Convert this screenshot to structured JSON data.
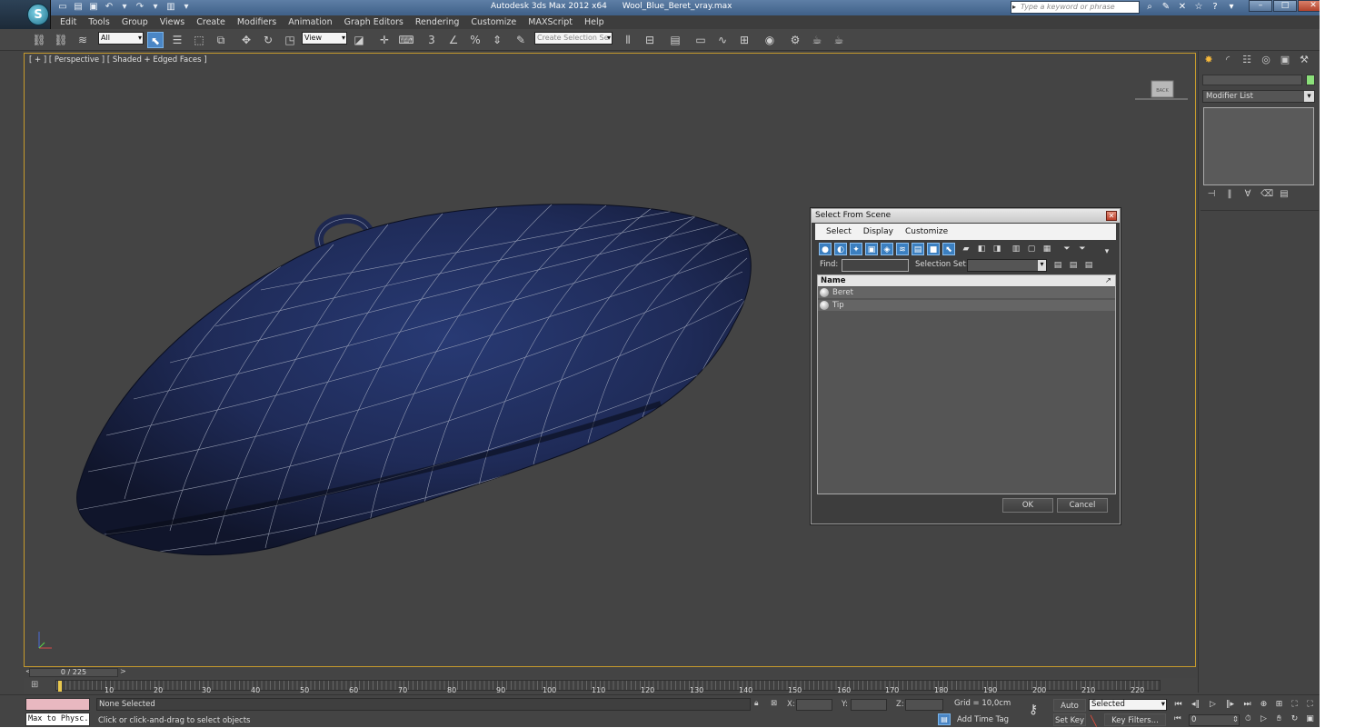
{
  "app": {
    "title": "Autodesk 3ds Max  2012 x64",
    "file": "Wool_Blue_Beret_vray.max",
    "search_placeholder": "Type a keyword or phrase",
    "logo_letter": "S"
  },
  "menu": [
    "Edit",
    "Tools",
    "Group",
    "Views",
    "Create",
    "Modifiers",
    "Animation",
    "Graph Editors",
    "Rendering",
    "Customize",
    "MAXScript",
    "Help"
  ],
  "toolbar": {
    "filter_value": "All",
    "refcoord_value": "View",
    "selection_set_placeholder": "Create Selection Se",
    "snap_3d": "3",
    "snap_percent": "%"
  },
  "viewport": {
    "label": "[ + ] [ Perspective ] [ Shaded + Edged Faces ]",
    "viewcube_face": "BACK",
    "colors": {
      "border": "#c79b2c",
      "beret": "#1f2a52",
      "wire": "#b9bfcf"
    }
  },
  "command_panel": {
    "modifier_list": "Modifier List",
    "object_color": "#8be07a"
  },
  "dialog": {
    "title": "Select From Scene",
    "menu": [
      "Select",
      "Display",
      "Customize"
    ],
    "find_label": "Find:",
    "selection_set_label": "Selection Set:",
    "column_name": "Name",
    "items": [
      {
        "name": "Beret"
      },
      {
        "name": "Tip"
      }
    ],
    "ok": "OK",
    "cancel": "Cancel"
  },
  "timeline": {
    "frame": "0 / 225",
    "ticks": [
      "10",
      "20",
      "30",
      "40",
      "50",
      "60",
      "70",
      "80",
      "90",
      "100",
      "110",
      "120",
      "130",
      "140",
      "150",
      "160",
      "170",
      "180",
      "190",
      "200",
      "210",
      "220"
    ]
  },
  "status": {
    "script_text": "Max to Physc.",
    "selection": "None Selected",
    "prompt": "Click or click-and-drag to select objects",
    "x_label": "X:",
    "y_label": "Y:",
    "z_label": "Z:",
    "grid": "Grid = 10,0cm",
    "add_time_tag": "Add Time Tag",
    "auto_key": "Auto Key",
    "set_key": "Set Key",
    "selected_value": "Selected",
    "key_filters": "Key Filters...",
    "frame_value": "0"
  }
}
